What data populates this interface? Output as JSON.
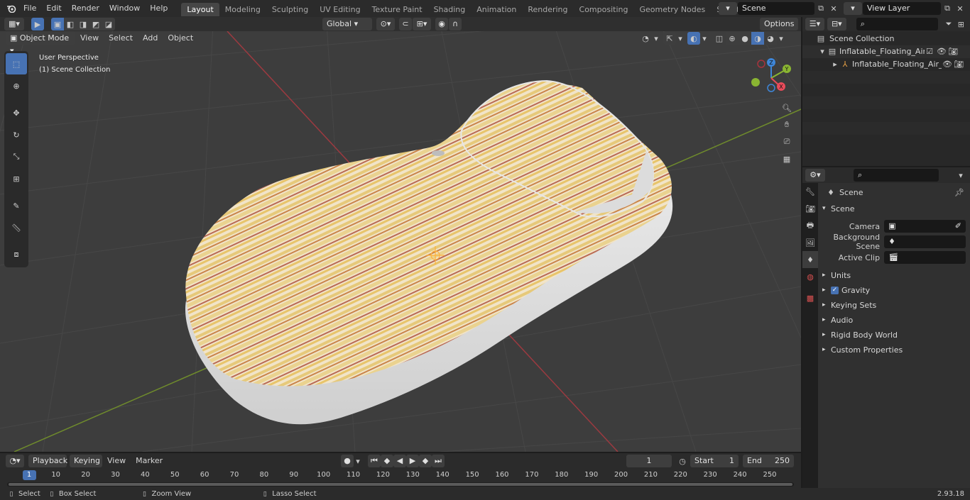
{
  "menu": [
    "File",
    "Edit",
    "Render",
    "Window",
    "Help"
  ],
  "workspaces": [
    "Layout",
    "Modeling",
    "Sculpting",
    "UV Editing",
    "Texture Paint",
    "Shading",
    "Animation",
    "Rendering",
    "Compositing",
    "Geometry Nodes",
    "Scripting"
  ],
  "active_workspace": "Layout",
  "scene_name": "Scene",
  "view_layer": "View Layer",
  "viewport": {
    "mode": "Object Mode",
    "menus": [
      "View",
      "Select",
      "Add",
      "Object"
    ],
    "transform_orientation": "Global",
    "options_label": "Options",
    "overlay_title": "User Perspective",
    "overlay_subtitle": "(1) Scene Collection"
  },
  "gizmo_axes": {
    "z": "Z",
    "y": "Y",
    "x": "X"
  },
  "outliner": {
    "collection": "Scene Collection",
    "items": [
      {
        "label": "Inflatable_Floating_Air_Mattre",
        "level": 1
      },
      {
        "label": "Inflatable_Floating_Air_M",
        "level": 2
      }
    ]
  },
  "properties": {
    "context": "Scene",
    "panel": "Scene",
    "fields": [
      {
        "label": "Camera",
        "value": ""
      },
      {
        "label": "Background Scene",
        "value": ""
      },
      {
        "label": "Active Clip",
        "value": ""
      }
    ],
    "subpanels": [
      "Units",
      "Gravity",
      "Keying Sets",
      "Audio",
      "Rigid Body World",
      "Custom Properties"
    ],
    "gravity_checked": true
  },
  "timeline": {
    "menus": [
      "Playback",
      "Keying",
      "View",
      "Marker"
    ],
    "current_frame": "1",
    "start_label": "Start",
    "start": "1",
    "end_label": "End",
    "end": "250",
    "ticks": [
      "1",
      "10",
      "20",
      "30",
      "40",
      "50",
      "60",
      "70",
      "80",
      "90",
      "100",
      "110",
      "120",
      "130",
      "140",
      "150",
      "160",
      "170",
      "180",
      "190",
      "200",
      "210",
      "220",
      "230",
      "240",
      "250"
    ]
  },
  "statusbar": {
    "items": [
      "Select",
      "Box Select",
      "Zoom View",
      "Lasso Select"
    ],
    "version": "2.93.18"
  },
  "colors": {
    "accent": "#4772b3",
    "x_axis": "#e94b5a",
    "y_axis": "#8ab532",
    "z_axis": "#3e86d8"
  }
}
